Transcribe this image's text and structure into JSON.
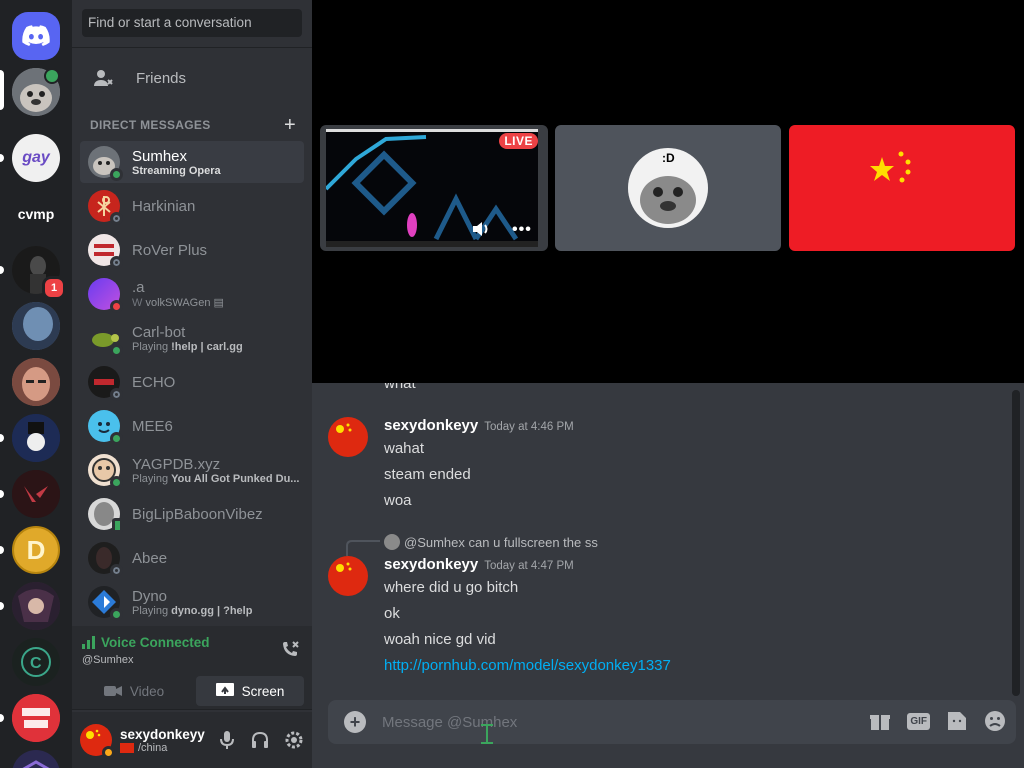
{
  "search": {
    "placeholder": "Find or start a conversation"
  },
  "friends_label": "Friends",
  "direct_messages_label": "DIRECT MESSAGES",
  "servers": [
    {
      "label": "cvmp"
    }
  ],
  "server_badge": "1",
  "dms": [
    {
      "name": "Sumhex",
      "sub": "Streaming Opera"
    },
    {
      "name": "Harkinian",
      "sub": ""
    },
    {
      "name": "RoVer Plus",
      "sub": ""
    },
    {
      "name": ".a",
      "sub": "volkSWAGen"
    },
    {
      "name": "Carl-bot",
      "sub_prefix": "Playing ",
      "sub_bold": "!help | carl.gg"
    },
    {
      "name": "ECHO",
      "sub": ""
    },
    {
      "name": "MEE6",
      "sub": ""
    },
    {
      "name": "YAGPDB.xyz",
      "sub_prefix": "Playing ",
      "sub_bold": "You All Got Punked Du..."
    },
    {
      "name": "BigLipBaboonVibez",
      "sub": ""
    },
    {
      "name": "Abee",
      "sub": ""
    },
    {
      "name": "Dyno",
      "sub_prefix": "Playing ",
      "sub_bold": "dyno.gg | ?help"
    }
  ],
  "voice": {
    "title": "Voice Connected",
    "channel": "@Sumhex",
    "video_label": "Video",
    "screen_label": "Screen"
  },
  "user": {
    "name": "sexydonkeyy",
    "status": "/china"
  },
  "stream": {
    "live_label": "LIVE"
  },
  "chat": {
    "partial": "what",
    "group1": {
      "author": "sexydonkeyy",
      "time": "Today at 4:46 PM",
      "lines": [
        "wahat",
        "steam ended",
        "woa"
      ]
    },
    "reply": "@Sumhex can u fullscreen the ss",
    "group2": {
      "author": "sexydonkeyy",
      "time": "Today at 4:47 PM",
      "lines": [
        "where did u go bitch",
        "ok",
        "woah nice gd vid"
      ],
      "link": "http://pornhub.com/model/sexydonkey1337"
    }
  },
  "composer": {
    "placeholder": "Message @Sumhex",
    "gif_label": "GIF"
  },
  "colors": {
    "online": "#3ba55d",
    "dnd": "#ed4245",
    "link": "#00aff4",
    "accent": "#5865f2",
    "flag_red": "#ee1c25",
    "flag_yellow": "#ffde00"
  }
}
